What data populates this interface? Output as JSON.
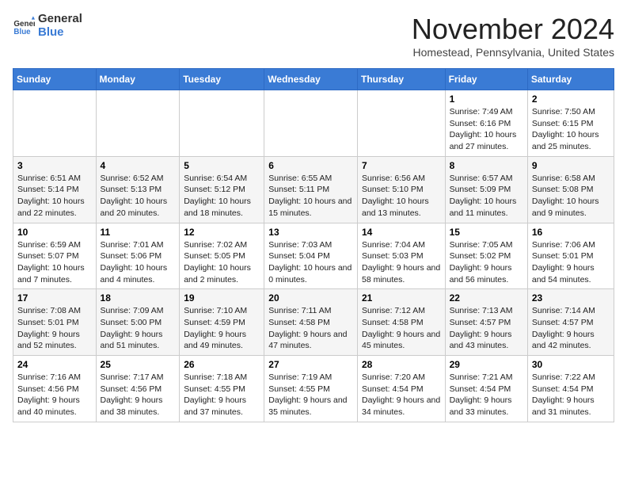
{
  "logo": {
    "general": "General",
    "blue": "Blue"
  },
  "title": "November 2024",
  "subtitle": "Homestead, Pennsylvania, United States",
  "weekdays": [
    "Sunday",
    "Monday",
    "Tuesday",
    "Wednesday",
    "Thursday",
    "Friday",
    "Saturday"
  ],
  "weeks": [
    [
      {
        "day": "",
        "info": ""
      },
      {
        "day": "",
        "info": ""
      },
      {
        "day": "",
        "info": ""
      },
      {
        "day": "",
        "info": ""
      },
      {
        "day": "",
        "info": ""
      },
      {
        "day": "1",
        "info": "Sunrise: 7:49 AM\nSunset: 6:16 PM\nDaylight: 10 hours and 27 minutes."
      },
      {
        "day": "2",
        "info": "Sunrise: 7:50 AM\nSunset: 6:15 PM\nDaylight: 10 hours and 25 minutes."
      }
    ],
    [
      {
        "day": "3",
        "info": "Sunrise: 6:51 AM\nSunset: 5:14 PM\nDaylight: 10 hours and 22 minutes."
      },
      {
        "day": "4",
        "info": "Sunrise: 6:52 AM\nSunset: 5:13 PM\nDaylight: 10 hours and 20 minutes."
      },
      {
        "day": "5",
        "info": "Sunrise: 6:54 AM\nSunset: 5:12 PM\nDaylight: 10 hours and 18 minutes."
      },
      {
        "day": "6",
        "info": "Sunrise: 6:55 AM\nSunset: 5:11 PM\nDaylight: 10 hours and 15 minutes."
      },
      {
        "day": "7",
        "info": "Sunrise: 6:56 AM\nSunset: 5:10 PM\nDaylight: 10 hours and 13 minutes."
      },
      {
        "day": "8",
        "info": "Sunrise: 6:57 AM\nSunset: 5:09 PM\nDaylight: 10 hours and 11 minutes."
      },
      {
        "day": "9",
        "info": "Sunrise: 6:58 AM\nSunset: 5:08 PM\nDaylight: 10 hours and 9 minutes."
      }
    ],
    [
      {
        "day": "10",
        "info": "Sunrise: 6:59 AM\nSunset: 5:07 PM\nDaylight: 10 hours and 7 minutes."
      },
      {
        "day": "11",
        "info": "Sunrise: 7:01 AM\nSunset: 5:06 PM\nDaylight: 10 hours and 4 minutes."
      },
      {
        "day": "12",
        "info": "Sunrise: 7:02 AM\nSunset: 5:05 PM\nDaylight: 10 hours and 2 minutes."
      },
      {
        "day": "13",
        "info": "Sunrise: 7:03 AM\nSunset: 5:04 PM\nDaylight: 10 hours and 0 minutes."
      },
      {
        "day": "14",
        "info": "Sunrise: 7:04 AM\nSunset: 5:03 PM\nDaylight: 9 hours and 58 minutes."
      },
      {
        "day": "15",
        "info": "Sunrise: 7:05 AM\nSunset: 5:02 PM\nDaylight: 9 hours and 56 minutes."
      },
      {
        "day": "16",
        "info": "Sunrise: 7:06 AM\nSunset: 5:01 PM\nDaylight: 9 hours and 54 minutes."
      }
    ],
    [
      {
        "day": "17",
        "info": "Sunrise: 7:08 AM\nSunset: 5:01 PM\nDaylight: 9 hours and 52 minutes."
      },
      {
        "day": "18",
        "info": "Sunrise: 7:09 AM\nSunset: 5:00 PM\nDaylight: 9 hours and 51 minutes."
      },
      {
        "day": "19",
        "info": "Sunrise: 7:10 AM\nSunset: 4:59 PM\nDaylight: 9 hours and 49 minutes."
      },
      {
        "day": "20",
        "info": "Sunrise: 7:11 AM\nSunset: 4:58 PM\nDaylight: 9 hours and 47 minutes."
      },
      {
        "day": "21",
        "info": "Sunrise: 7:12 AM\nSunset: 4:58 PM\nDaylight: 9 hours and 45 minutes."
      },
      {
        "day": "22",
        "info": "Sunrise: 7:13 AM\nSunset: 4:57 PM\nDaylight: 9 hours and 43 minutes."
      },
      {
        "day": "23",
        "info": "Sunrise: 7:14 AM\nSunset: 4:57 PM\nDaylight: 9 hours and 42 minutes."
      }
    ],
    [
      {
        "day": "24",
        "info": "Sunrise: 7:16 AM\nSunset: 4:56 PM\nDaylight: 9 hours and 40 minutes."
      },
      {
        "day": "25",
        "info": "Sunrise: 7:17 AM\nSunset: 4:56 PM\nDaylight: 9 hours and 38 minutes."
      },
      {
        "day": "26",
        "info": "Sunrise: 7:18 AM\nSunset: 4:55 PM\nDaylight: 9 hours and 37 minutes."
      },
      {
        "day": "27",
        "info": "Sunrise: 7:19 AM\nSunset: 4:55 PM\nDaylight: 9 hours and 35 minutes."
      },
      {
        "day": "28",
        "info": "Sunrise: 7:20 AM\nSunset: 4:54 PM\nDaylight: 9 hours and 34 minutes."
      },
      {
        "day": "29",
        "info": "Sunrise: 7:21 AM\nSunset: 4:54 PM\nDaylight: 9 hours and 33 minutes."
      },
      {
        "day": "30",
        "info": "Sunrise: 7:22 AM\nSunset: 4:54 PM\nDaylight: 9 hours and 31 minutes."
      }
    ]
  ]
}
